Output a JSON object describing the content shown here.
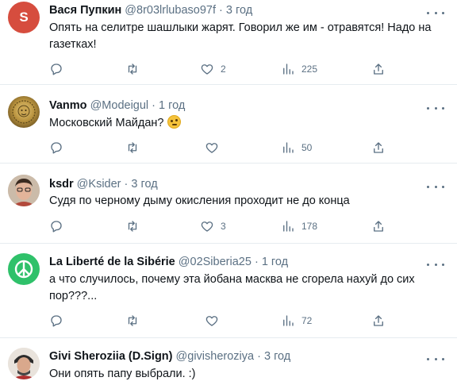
{
  "tweets": [
    {
      "avatar_letter": "S",
      "avatar_color": "#d64d3e",
      "name": "Вася Пупкин",
      "handle": "@8r03lrlubaso97f",
      "dot": "·",
      "time": "3 год",
      "text": "Опять на селитре шашлыки жарят. Говорил же им - отравятся! Надо на газетках!",
      "likes": "2",
      "views": "225"
    },
    {
      "name": "Vanmo",
      "handle": "@Modeigul",
      "dot": "·",
      "time": "1 год",
      "text": "Московский Майдан?",
      "views": "50"
    },
    {
      "name": "ksdr",
      "handle": "@Ksider",
      "dot": "·",
      "time": "3 год",
      "text": "Судя по черному дыму окисления проходит не до конца",
      "likes": "3",
      "views": "178"
    },
    {
      "name": "La Liberté de la Sibérie",
      "handle": "@02Siberia25",
      "dot": "·",
      "time": "1 год",
      "text": "а что случилось, почему эта йобана масква не сгорела нахуй до сих пор???...",
      "views": "72"
    },
    {
      "name": "Givi Sheroziia (D.Sign)",
      "handle": "@givisheroziya",
      "dot": "·",
      "time": "3 год",
      "text": "Они опять папу выбрали. :)"
    }
  ],
  "colors": {
    "text": "#0f1419",
    "muted": "#5b7083",
    "divider": "#e6ecf0",
    "peace_bg": "#2fc16a"
  },
  "icons": [
    "reply-icon",
    "retweet-icon",
    "like-icon",
    "views-icon",
    "share-icon",
    "more-icon"
  ]
}
